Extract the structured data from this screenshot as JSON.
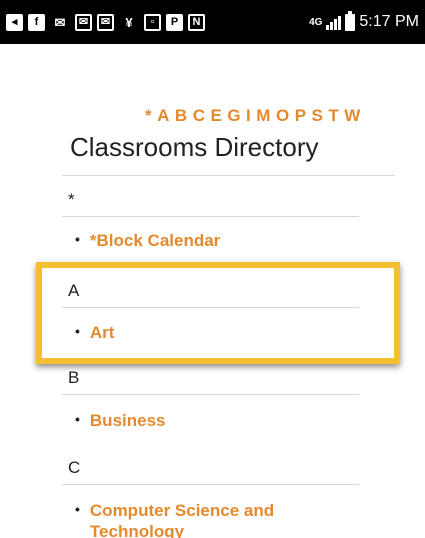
{
  "status_bar": {
    "left_icons": [
      "notification-icon",
      "facebook-icon",
      "gmail-icon",
      "mail-icon",
      "mail-icon",
      "wallet-icon",
      "image-icon",
      "parking-icon",
      "nfc-icon"
    ],
    "network_label": "4G",
    "time": "5:17 PM"
  },
  "alphabet_index": [
    "*",
    "A",
    "B",
    "C",
    "E",
    "G",
    "I",
    "M",
    "O",
    "P",
    "S",
    "T",
    "W"
  ],
  "page_title": "Classrooms Directory",
  "sections": [
    {
      "letter": "*",
      "items": [
        "*Block Calendar"
      ]
    },
    {
      "letter": "A",
      "items": [
        "Art"
      ]
    },
    {
      "letter": "B",
      "items": [
        "Business"
      ]
    },
    {
      "letter": "C",
      "items": [
        "Computer Science and Technology"
      ]
    }
  ],
  "colors": {
    "accent": "#e48a2c",
    "highlight": "#f4c032",
    "status_bar_bg": "#000000"
  }
}
